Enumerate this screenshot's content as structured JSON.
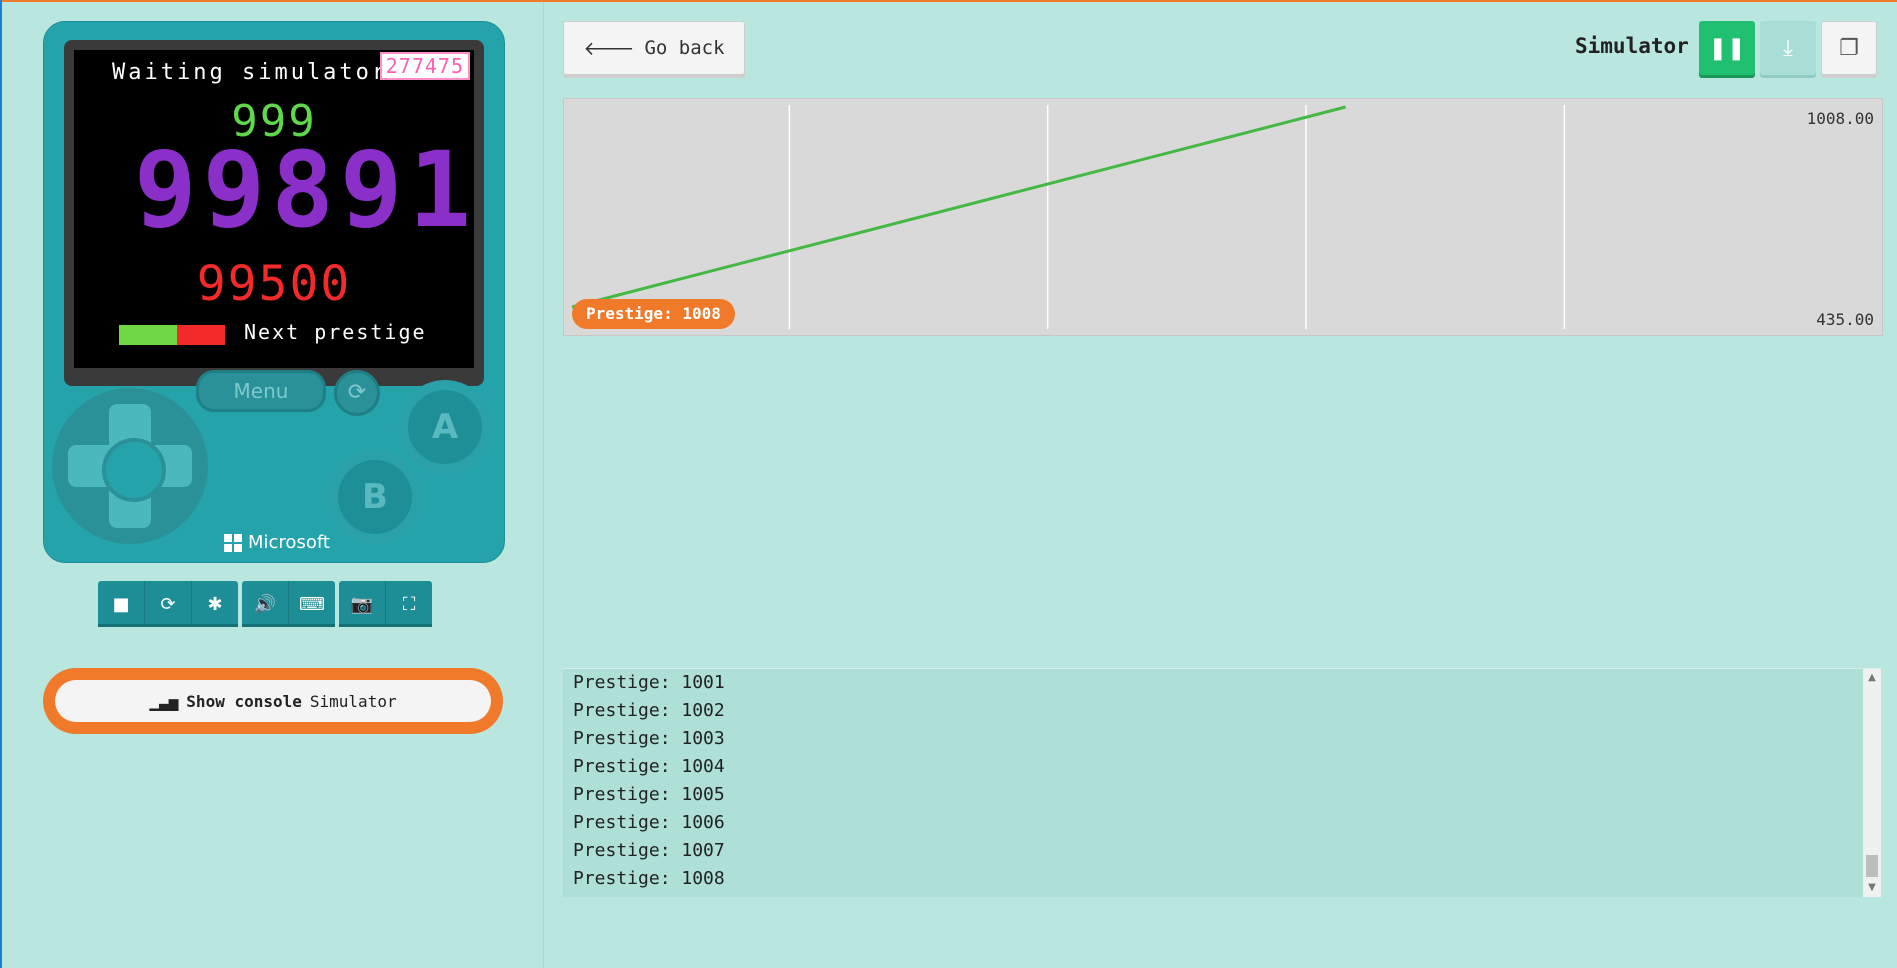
{
  "device": {
    "screen": {
      "waiting_text": "Waiting simulator...",
      "counter_badge": "277475",
      "top_number": "999",
      "main_number": "99891",
      "bottom_number": "99500",
      "progress_fraction": 0.55,
      "progress_label": "Next prestige"
    },
    "menu_label": "Menu",
    "button_a": "A",
    "button_b": "B",
    "brand": "Microsoft"
  },
  "toolbar": {
    "icons": [
      "stop-icon",
      "restart-icon",
      "debug-icon",
      "sound-icon",
      "keyboard-icon",
      "screenshot-icon",
      "fullscreen-icon"
    ]
  },
  "console_toggle": {
    "label_bold": "Show console",
    "label_rest": "Simulator"
  },
  "header": {
    "go_back_label": "Go back",
    "simulator_label": "Simulator"
  },
  "chart_data": {
    "type": "line",
    "series": [
      {
        "name": "Prestige",
        "values": [
          435,
          1008
        ]
      }
    ],
    "x": [
      0,
      1
    ],
    "ylim": [
      435,
      1008
    ],
    "y_max_label": "1008.00",
    "y_min_label": "435.00",
    "badge_label": "Prestige: 1008",
    "line_color": "#43b843",
    "grid": "vertical"
  },
  "console": {
    "lines": [
      "Prestige: 1001",
      "Prestige: 1002",
      "Prestige: 1003",
      "Prestige: 1004",
      "Prestige: 1005",
      "Prestige: 1006",
      "Prestige: 1007",
      "Prestige: 1008"
    ]
  },
  "colors": {
    "accent_orange": "#f07a2a",
    "device_teal": "#24a3ab",
    "pause_green": "#21c070",
    "page_bg": "#b9e6df"
  }
}
